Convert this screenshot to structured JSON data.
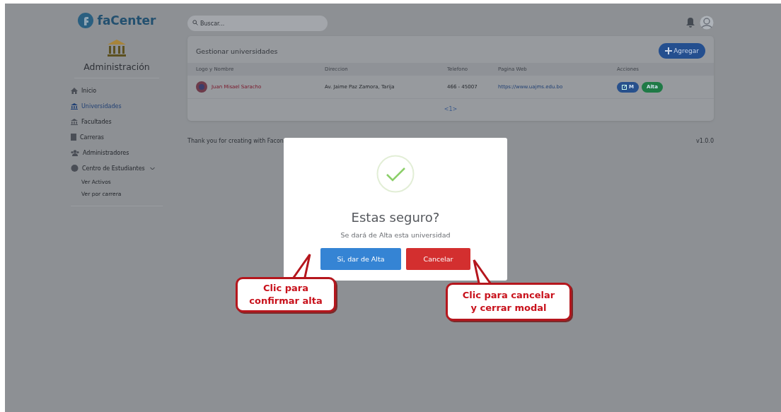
{
  "brand": "faCenter",
  "search": {
    "placeholder": "Buscar..."
  },
  "sidebar": {
    "title": "Administración",
    "items": [
      {
        "label": "Inicio",
        "selected": false
      },
      {
        "label": "Universidades",
        "selected": true
      },
      {
        "label": "Facultades",
        "selected": false
      },
      {
        "label": "Carreras",
        "selected": false
      },
      {
        "label": "Administradores",
        "selected": false
      },
      {
        "label": "Centro de Estudiantes",
        "selected": false,
        "expanded": true,
        "children": [
          {
            "label": "Ver Activos"
          },
          {
            "label": "Ver por carrera"
          }
        ]
      }
    ]
  },
  "card": {
    "title": "Gestionar universidades",
    "add_button": "Agregar",
    "columns": [
      "Logo y Nombre",
      "Direccion",
      "Telefono",
      "Pagina Web",
      "Acciones"
    ],
    "rows": [
      {
        "name": "Juan Misael Saracho",
        "address": "Av. Jaime Paz Zamora, Tarija",
        "phone": "466 - 45007",
        "website": "https://www.uajms.edu.bo",
        "actions": [
          {
            "kind": "edit",
            "label": "M"
          },
          {
            "kind": "enable",
            "label": "Alta"
          }
        ]
      }
    ],
    "pagination": "<1>"
  },
  "footer": {
    "text": "Thank you for creating with Facon",
    "version": "v1.0.0"
  },
  "modal": {
    "title": "Estas seguro?",
    "message": "Se dará de Alta esta universidad",
    "confirm": "Si, dar de Alta",
    "cancel": "Cancelar"
  },
  "callouts": [
    {
      "kind": "confirm",
      "text": "Clic para\nconfirmar alta"
    },
    {
      "kind": "cancel",
      "text": "Clic para cancelar\ny cerrar modal"
    }
  ]
}
